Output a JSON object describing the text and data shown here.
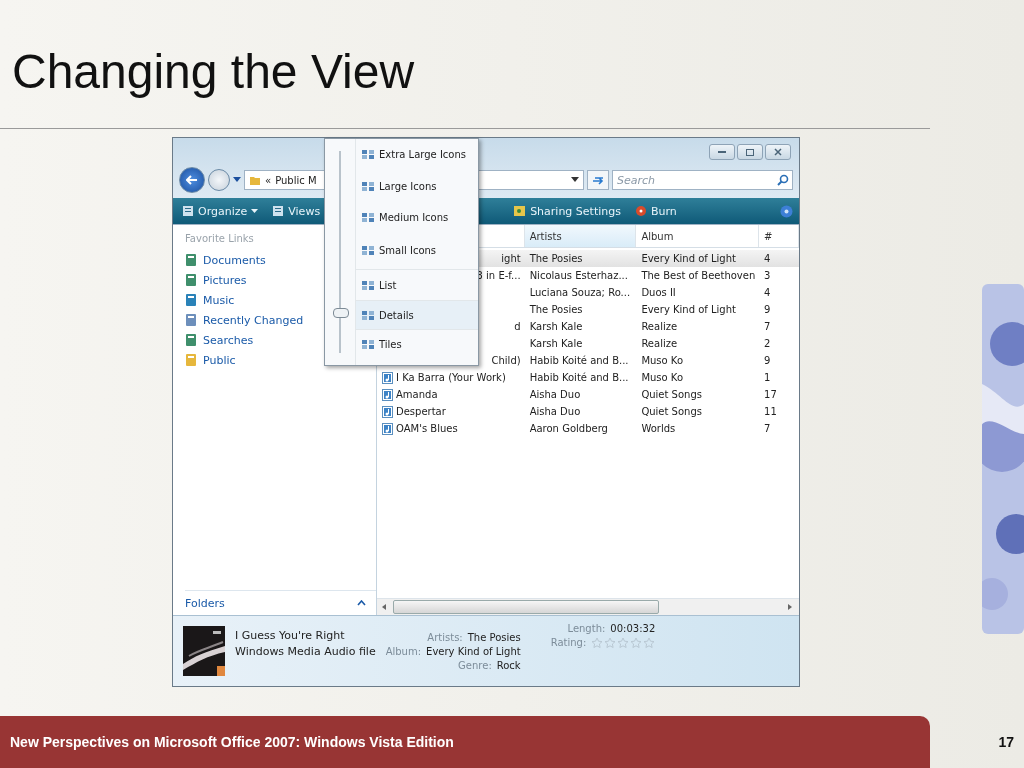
{
  "slide": {
    "title": "Changing the View",
    "footer": "New Perspectives on Microsoft Office 2007: Windows Vista Edition",
    "page_number": "17"
  },
  "window": {
    "address": {
      "prefix": "«",
      "path": "Public M"
    },
    "search": {
      "placeholder": "Search"
    },
    "toolbar": [
      {
        "label": "Organize",
        "kind": "menu"
      },
      {
        "label": "Views",
        "kind": "menu"
      },
      {
        "label": "Sharing Settings",
        "kind": "share"
      },
      {
        "label": "Burn",
        "kind": "burn"
      }
    ],
    "sidebar": {
      "heading": "Favorite Links",
      "items": [
        {
          "label": "Documents",
          "kind": "documents"
        },
        {
          "label": "Pictures",
          "kind": "pictures"
        },
        {
          "label": "Music",
          "kind": "music"
        },
        {
          "label": "Recently Changed",
          "kind": "recent"
        },
        {
          "label": "Searches",
          "kind": "searches"
        },
        {
          "label": "Public",
          "kind": "folder"
        }
      ],
      "folders": "Folders"
    },
    "table": {
      "columns": [
        "Artists",
        "Album",
        "#"
      ],
      "rows": [
        {
          "name": "ight",
          "clipped": true,
          "selected": true,
          "artists": "The Posies",
          "album": "Every Kind of Light",
          "number": "4"
        },
        {
          "name": "3 in E-f...",
          "clipped": true,
          "selected": false,
          "artists": "Nicolaus Esterhaz...",
          "album": "The Best of Beethoven",
          "number": "3"
        },
        {
          "selected": false,
          "artists": "Luciana Souza; Ro...",
          "album": "Duos II",
          "number": "4"
        },
        {
          "selected": false,
          "artists": "The Posies",
          "album": "Every Kind of Light",
          "number": "9"
        },
        {
          "name": "d",
          "clipped": true,
          "selected": false,
          "artists": "Karsh Kale",
          "album": "Realize",
          "number": "7"
        },
        {
          "selected": false,
          "artists": "Karsh Kale",
          "album": "Realize",
          "number": "2"
        },
        {
          "name": "Child)",
          "clipped": true,
          "selected": false,
          "artists": "Habib Koité and B...",
          "album": "Muso Ko",
          "number": "9"
        },
        {
          "name": "I Ka Barra (Your Work)",
          "clipped": false,
          "selected": false,
          "artists": "Habib Koité and B...",
          "album": "Muso Ko",
          "number": "1"
        },
        {
          "name": "Amanda",
          "clipped": false,
          "selected": false,
          "artists": "Aisha Duo",
          "album": "Quiet Songs",
          "number": "17"
        },
        {
          "name": "Despertar",
          "clipped": false,
          "selected": false,
          "artists": "Aisha Duo",
          "album": "Quiet Songs",
          "number": "11"
        },
        {
          "name": "OAM's Blues",
          "clipped": false,
          "selected": false,
          "artists": "Aaron Goldberg",
          "album": "Worlds",
          "number": "7"
        }
      ]
    },
    "views_menu": [
      {
        "label": "Extra Large Icons",
        "selected": false
      },
      {
        "label": "Large Icons",
        "selected": false
      },
      {
        "label": "Medium Icons",
        "selected": false
      },
      {
        "label": "Small Icons",
        "selected": false
      },
      {
        "label": "List",
        "selected": false
      },
      {
        "label": "Details",
        "selected": true
      },
      {
        "label": "Tiles",
        "selected": false
      }
    ],
    "details": {
      "title": "I Guess You're Right",
      "type": "Windows Media Audio file",
      "properties": [
        {
          "label": "Artists:",
          "value": "The Posies"
        },
        {
          "label": "Album:",
          "value": "Every Kind of Light"
        },
        {
          "label": "Genre:",
          "value": "Rock"
        }
      ],
      "length_label": "Length:",
      "length": "00:03:32",
      "rating_label": "Rating:",
      "stars": 0
    }
  }
}
